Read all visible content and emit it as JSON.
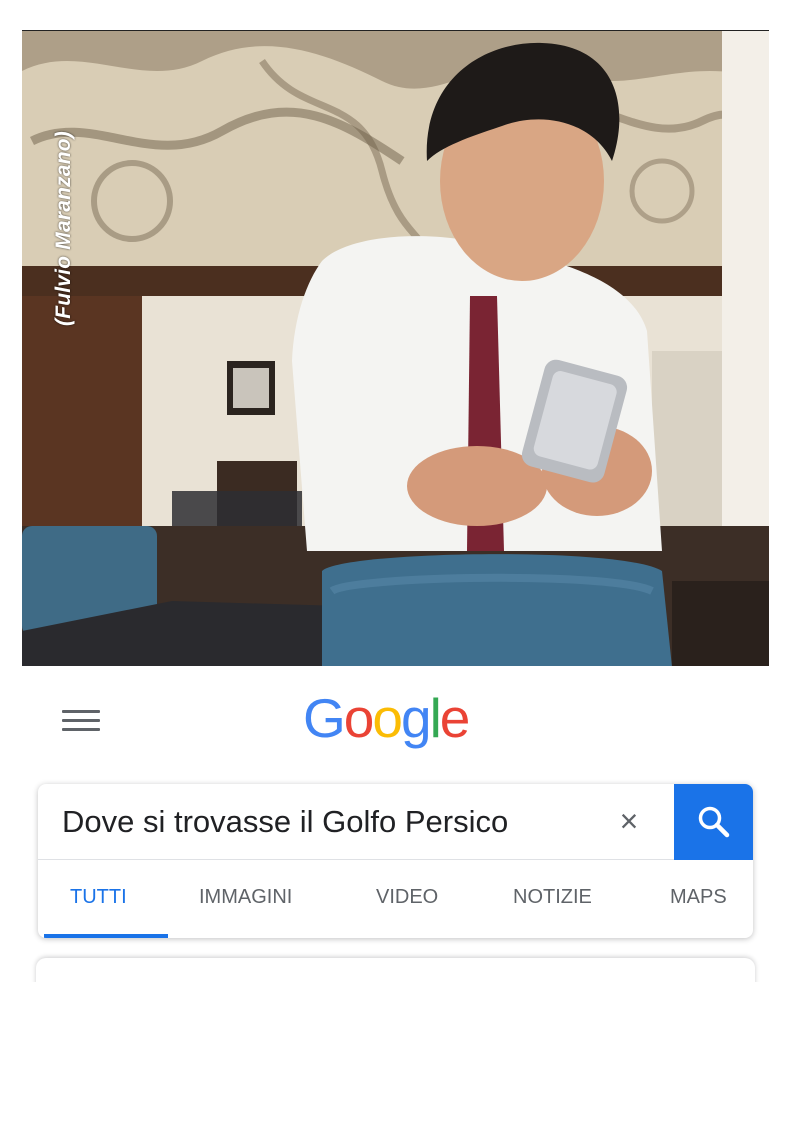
{
  "photo": {
    "credit": "(Fulvio Maranzano)",
    "description_icon": "photo"
  },
  "header": {
    "menu_icon": "hamburger-menu-icon",
    "logo": [
      "G",
      "o",
      "o",
      "g",
      "l",
      "e"
    ]
  },
  "search": {
    "query": "Dove si trovasse il Golfo Persico",
    "clear_icon": "close-icon",
    "search_icon": "search-icon"
  },
  "tabs": [
    {
      "label": "TUTTI",
      "active": true
    },
    {
      "label": "IMMAGINI",
      "active": false
    },
    {
      "label": "VIDEO",
      "active": false
    },
    {
      "label": "NOTIZIE",
      "active": false
    },
    {
      "label": "MAPS",
      "active": false
    }
  ],
  "colors": {
    "accent_blue": "#1a73e8",
    "google_blue": "#4285F4",
    "google_red": "#EA4335",
    "google_yellow": "#FBBC05",
    "google_green": "#34A853"
  }
}
